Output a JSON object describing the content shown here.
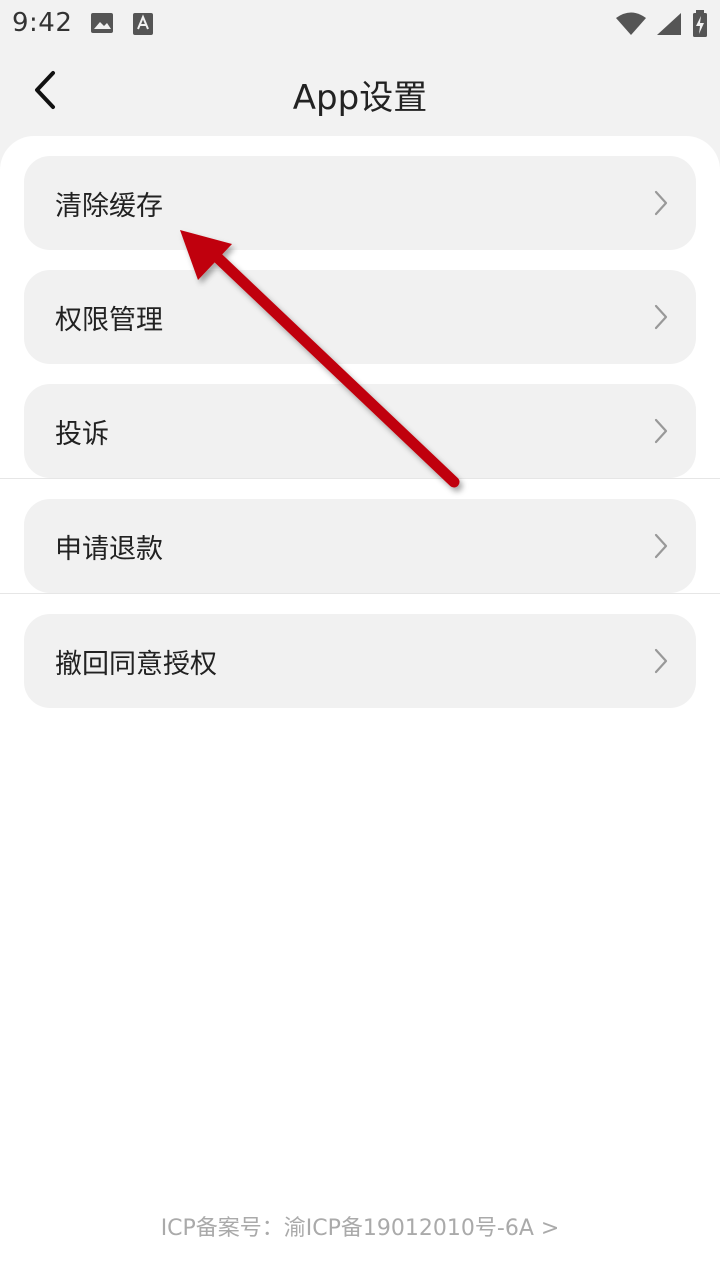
{
  "status_bar": {
    "time": "9:42",
    "left_icons": [
      "image-icon",
      "font-a-icon"
    ],
    "right_icons": [
      "wifi-icon",
      "signal-icon",
      "battery-charging-icon"
    ]
  },
  "nav": {
    "title": "App设置",
    "back_icon": "chevron-left-icon"
  },
  "menu": {
    "items": [
      {
        "label": "清除缓存"
      },
      {
        "label": "权限管理"
      },
      {
        "label": "投诉"
      },
      {
        "label": "申请退款"
      },
      {
        "label": "撤回同意授权"
      }
    ]
  },
  "footer": {
    "icp": "ICP备案号：渝ICP备19012010号-6A >"
  },
  "colors": {
    "page_bg": "#f2f2f2",
    "content_bg": "#ffffff",
    "item_bg": "#f1f1f1",
    "annotation_arrow": "#c0000a"
  }
}
